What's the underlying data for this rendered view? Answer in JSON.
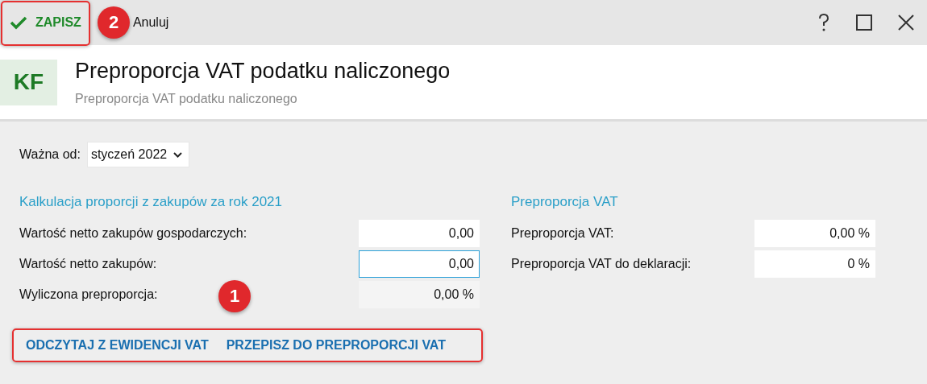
{
  "toolbar": {
    "save": {
      "label": "ZAPISZ",
      "callout": "2"
    },
    "cancel": {
      "label": "Anuluj"
    }
  },
  "header": {
    "badge": "KF",
    "title": "Preproporcja VAT podatku naliczonego",
    "subtitle": "Preproporcja VAT podatku naliczonego"
  },
  "valid_from": {
    "label": "Ważna od:",
    "value": "styczeń 2022"
  },
  "left_section": {
    "heading": "Kalkulacja proporcji z zakupów za rok 2021",
    "rows": [
      {
        "label": "Wartość netto zakupów gospodarczych:",
        "value": "0,00",
        "kind": "input",
        "focused": false
      },
      {
        "label": "Wartość netto zakupów:",
        "value": "0,00",
        "kind": "input",
        "focused": true
      },
      {
        "label": "Wyliczona preproporcja:",
        "value": "0,00 %",
        "kind": "readonly",
        "focused": false
      }
    ]
  },
  "right_section": {
    "heading": "Preproporcja VAT",
    "rows": [
      {
        "label": "Preproporcja VAT:",
        "value": "0,00 %",
        "kind": "input",
        "focused": false
      },
      {
        "label": "Preproporcja VAT do deklaracji:",
        "value": "0 %",
        "kind": "input",
        "focused": false
      }
    ]
  },
  "actions": {
    "callout": "1",
    "buttons": [
      {
        "label": "ODCZYTAJ Z EWIDENCJI VAT"
      },
      {
        "label": "PRZEPISZ DO PREPROPORCJI VAT"
      }
    ]
  }
}
